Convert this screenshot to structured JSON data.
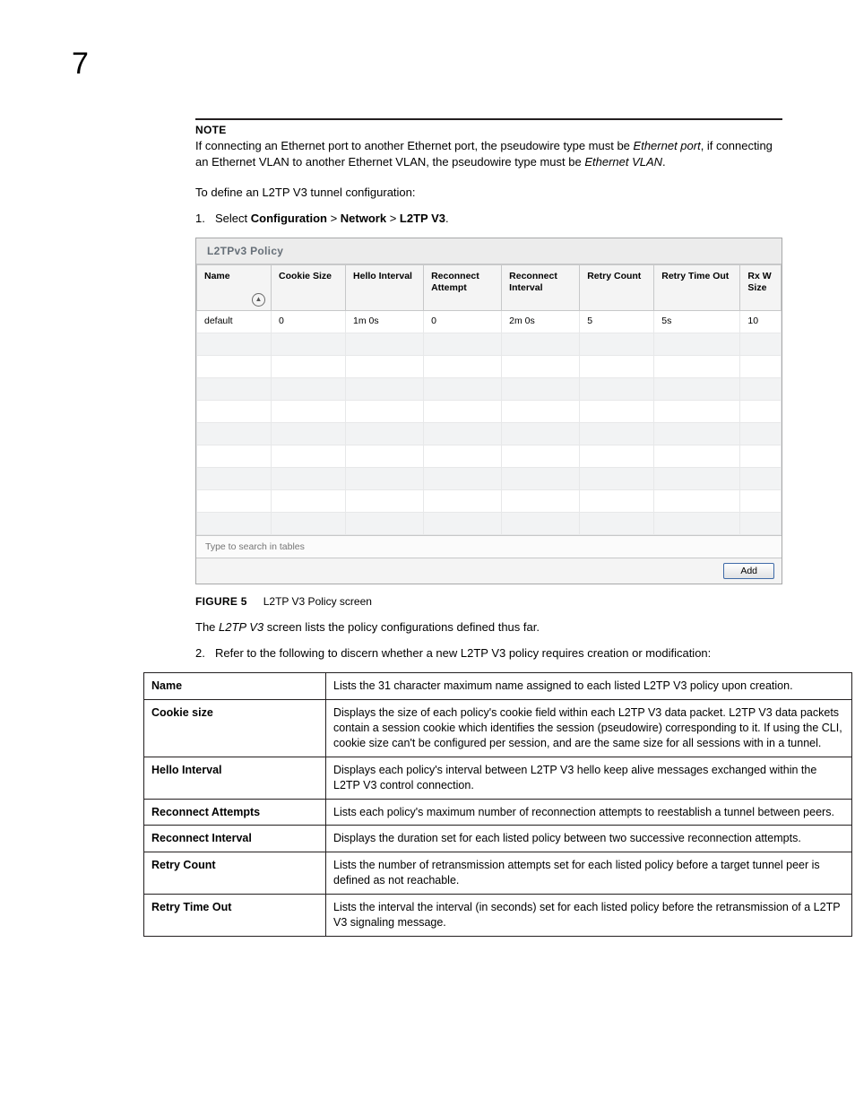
{
  "chapter_number": "7",
  "note": {
    "heading": "NOTE",
    "body_pre": "If connecting an Ethernet port to another Ethernet port, the pseudowire type must be ",
    "body_em1": "Ethernet port",
    "body_mid": ", if connecting an Ethernet VLAN to another Ethernet VLAN, the pseudowire type must be ",
    "body_em2": "Ethernet VLAN",
    "body_post": "."
  },
  "intro": "To define an L2TP V3 tunnel configuration:",
  "step1": {
    "num": "1.",
    "pre": "Select ",
    "b1": "Configuration",
    "sep1": " > ",
    "b2": "Network",
    "sep2": " > ",
    "b3": "L2TP V3",
    "post": "."
  },
  "shot": {
    "title": "L2TPv3 Policy",
    "headers": [
      "Name",
      "Cookie Size",
      "Hello Interval",
      "Reconnect Attempt",
      "Reconnect Interval",
      "Retry Count",
      "Retry Time Out",
      "Rx W Size"
    ],
    "row": [
      "default",
      "0",
      "1m 0s",
      "0",
      "2m 0s",
      "5",
      "5s",
      "10"
    ],
    "search_placeholder": "Type to search in tables",
    "add_label": "Add"
  },
  "figure": {
    "label": "FIGURE 5",
    "caption": "L2TP V3 Policy screen"
  },
  "para_pre": "The ",
  "para_em": "L2TP V3",
  "para_post": " screen lists the policy configurations defined thus far.",
  "step2": {
    "num": "2.",
    "text": "Refer to the following to discern whether a new L2TP V3 policy requires creation or modification:"
  },
  "desc": [
    {
      "field": "Name",
      "text": "Lists the 31 character maximum name assigned to each listed L2TP V3 policy upon creation."
    },
    {
      "field": "Cookie size",
      "text": "Displays the size of each policy's cookie field within each L2TP V3 data packet. L2TP V3 data packets contain a session cookie which identifies the session (pseudowire) corresponding to it. If using the CLI, cookie size can't be configured per session, and are the same size for all sessions with in a tunnel."
    },
    {
      "field": "Hello Interval",
      "text": "Displays each policy's interval between L2TP V3 hello keep alive messages exchanged within the L2TP V3 control connection."
    },
    {
      "field": "Reconnect Attempts",
      "text": "Lists each policy's maximum number of reconnection attempts to reestablish a tunnel between peers."
    },
    {
      "field": "Reconnect Interval",
      "text": "Displays the duration set for each listed policy between two successive reconnection attempts."
    },
    {
      "field": "Retry Count",
      "text": "Lists the number of retransmission attempts set for each listed policy before a target tunnel peer is defined as not reachable."
    },
    {
      "field": "Retry Time Out",
      "text": "Lists the interval the interval (in seconds) set for each listed policy before the retransmission of a L2TP V3 signaling message."
    }
  ]
}
